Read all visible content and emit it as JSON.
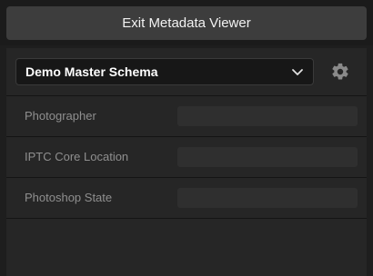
{
  "header": {
    "exit_button_label": "Exit Metadata Viewer"
  },
  "schema": {
    "selected": "Demo Master Schema",
    "dropdown_icon": "chevron-down-icon",
    "settings_icon": "gear-icon"
  },
  "fields": [
    {
      "label": "Photographer",
      "value": ""
    },
    {
      "label": "IPTC Core Location",
      "value": ""
    },
    {
      "label": "Photoshop State",
      "value": ""
    }
  ],
  "colors": {
    "background": "#1e1e1e",
    "panel": "#262626",
    "button": "#3d3d3d",
    "input": "#2f2f2f",
    "label": "#8f8f8f"
  }
}
